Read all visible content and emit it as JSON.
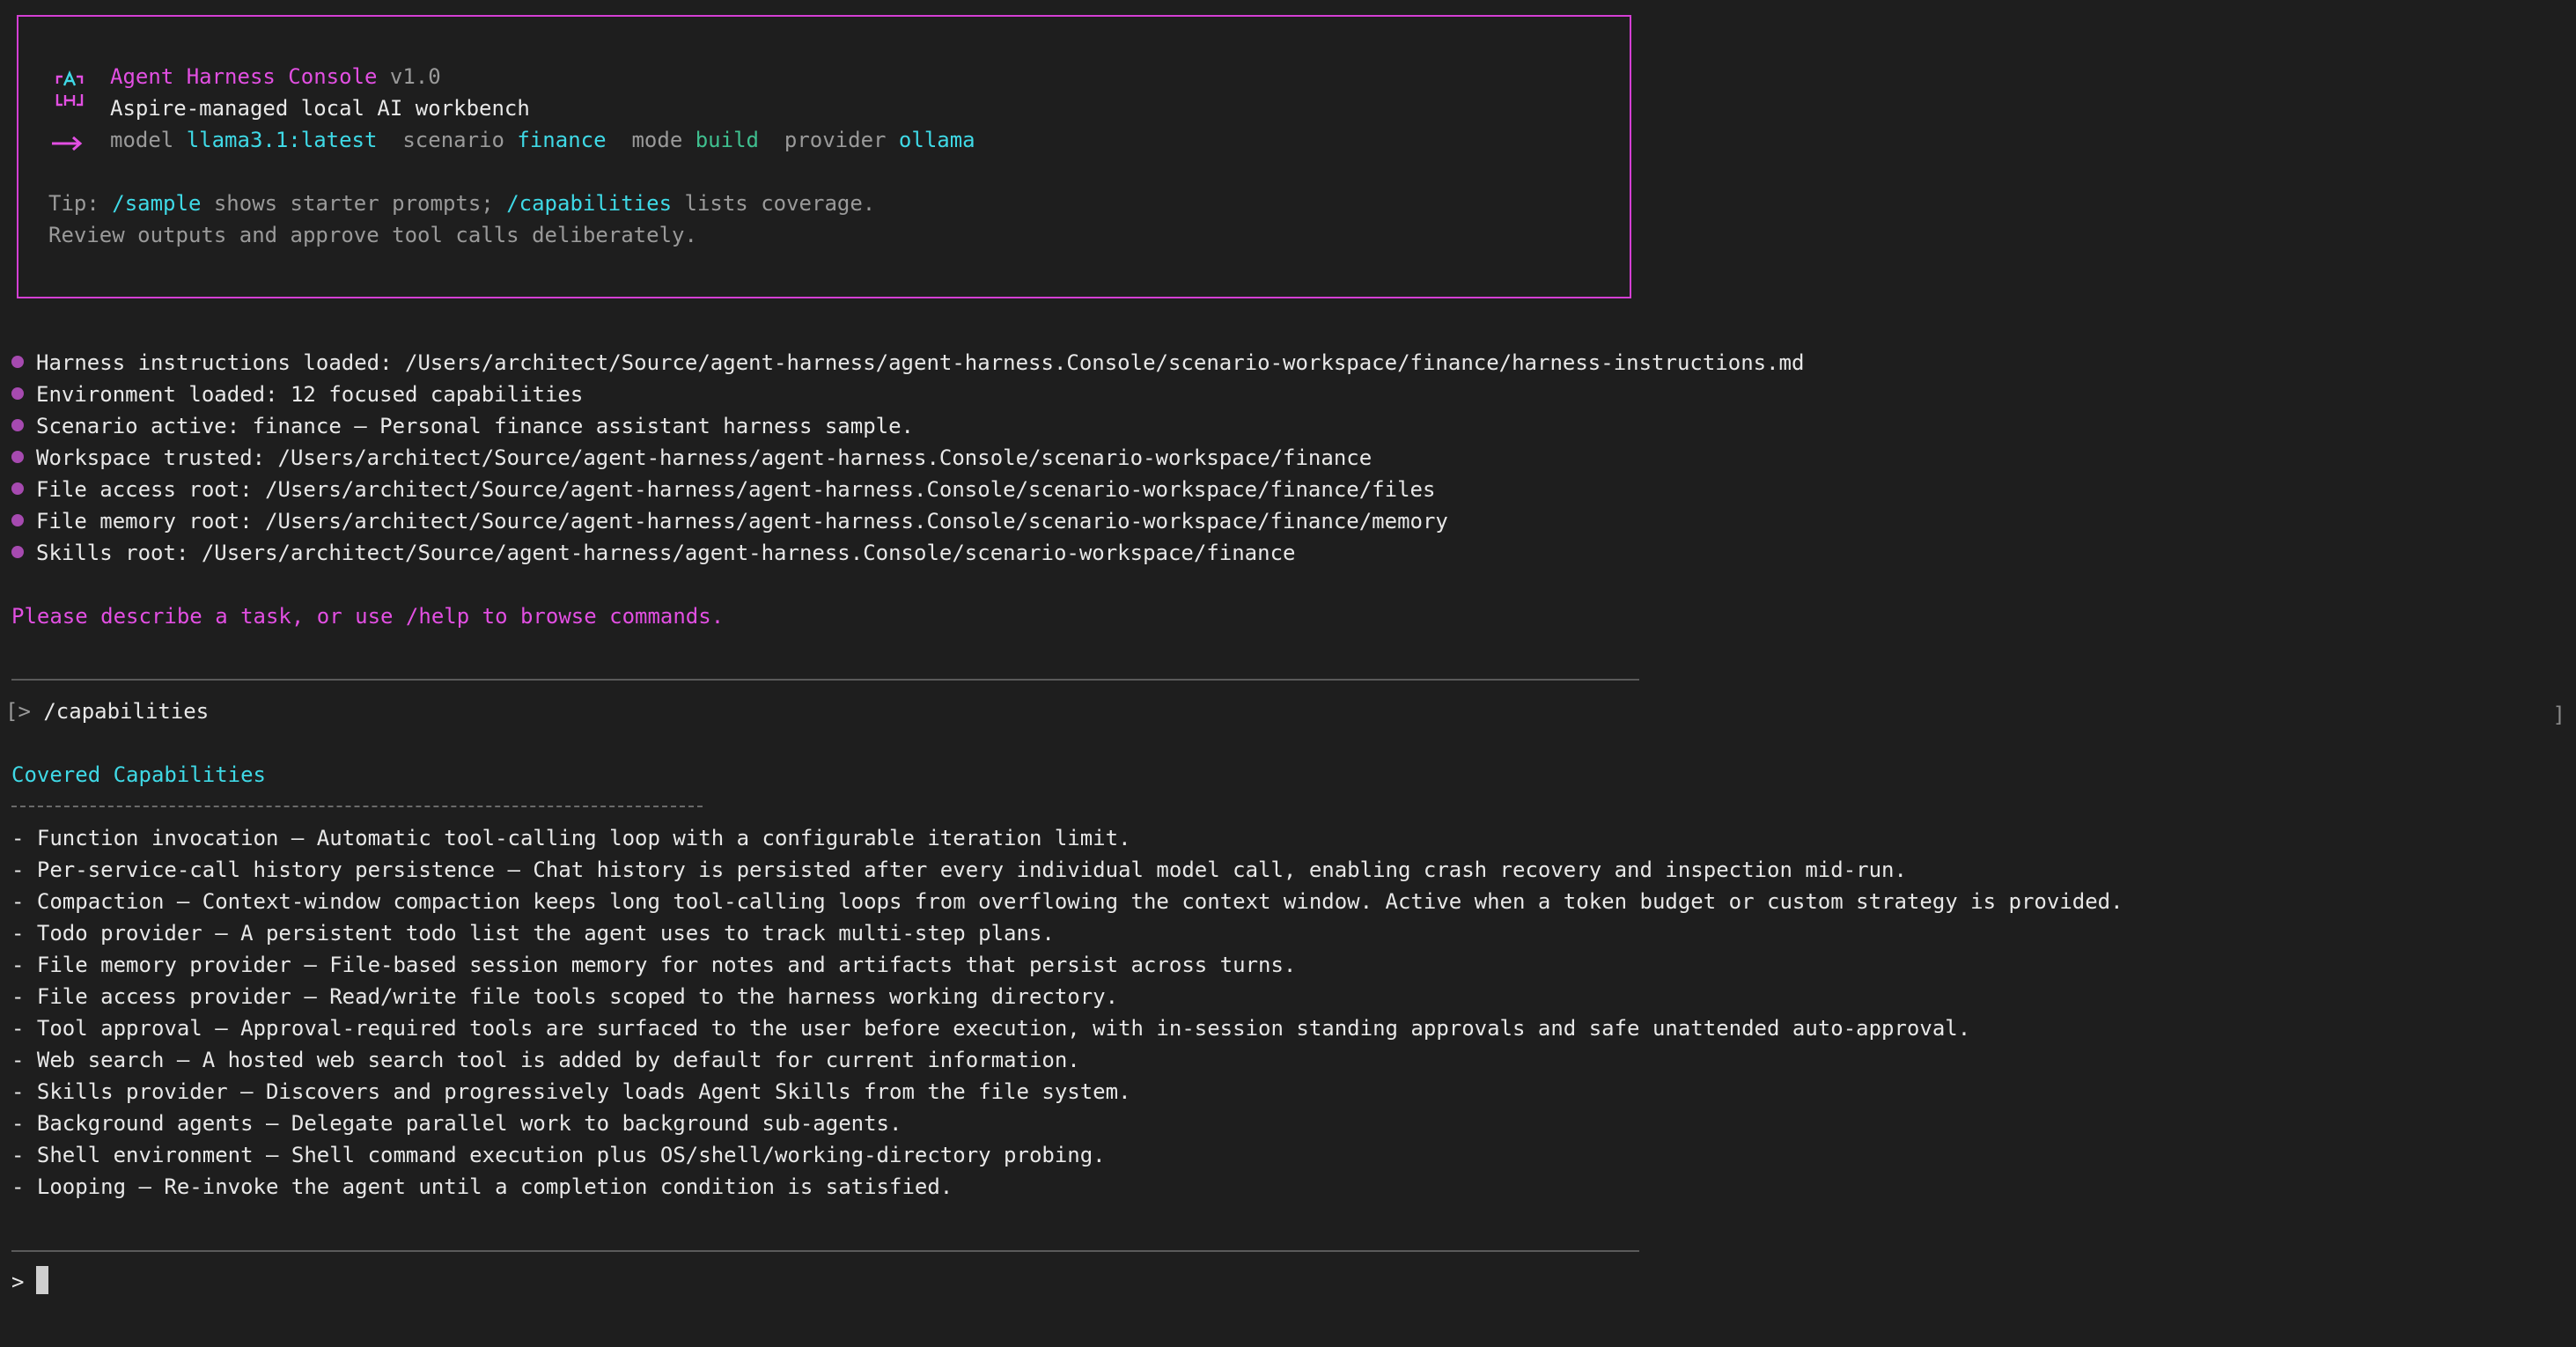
{
  "banner": {
    "app_name": "Agent Harness Console",
    "version": "v1.0",
    "subtitle": "Aspire-managed local AI workbench",
    "status": {
      "model_label": "model",
      "model_value": "llama3.1:latest",
      "scenario_label": "scenario",
      "scenario_value": "finance",
      "mode_label": "mode",
      "mode_value": "build",
      "provider_label": "provider",
      "provider_value": "ollama"
    },
    "tip": {
      "prefix": "Tip:",
      "cmd1": "/sample",
      "text1": "shows starter prompts;",
      "cmd2": "/capabilities",
      "text2": "lists coverage."
    },
    "tip2": "Review outputs and approve tool calls deliberately."
  },
  "status_lines": [
    "Harness instructions loaded: /Users/architect/Source/agent-harness/agent-harness.Console/scenario-workspace/finance/harness-instructions.md",
    "Environment loaded: 12 focused capabilities",
    "Scenario active: finance – Personal finance assistant harness sample.",
    "Workspace trusted: /Users/architect/Source/agent-harness/agent-harness.Console/scenario-workspace/finance",
    "File access root: /Users/architect/Source/agent-harness/agent-harness.Console/scenario-workspace/finance/files",
    "File memory root: /Users/architect/Source/agent-harness/agent-harness.Console/scenario-workspace/finance/memory",
    "Skills root: /Users/architect/Source/agent-harness/agent-harness.Console/scenario-workspace/finance"
  ],
  "prompt_hint": "Please describe a task, or use /help to browse commands.",
  "command_entry": {
    "prompt": "[>",
    "command": "/capabilities",
    "right_bracket": "]"
  },
  "capabilities": {
    "heading": "Covered Capabilities",
    "items": [
      "- Function invocation – Automatic tool-calling loop with a configurable iteration limit.",
      "- Per-service-call history persistence – Chat history is persisted after every individual model call, enabling crash recovery and inspection mid-run.",
      "- Compaction – Context-window compaction keeps long tool-calling loops from overflowing the context window. Active when a token budget or custom strategy is provided.",
      "- Todo provider – A persistent todo list the agent uses to track multi-step plans.",
      "- File memory provider – File-based session memory for notes and artifacts that persist across turns.",
      "- File access provider – Read/write file tools scoped to the harness working directory.",
      "- Tool approval – Approval-required tools are surfaced to the user before execution, with in-session standing approvals and safe unattended auto-approval.",
      "- Web search – A hosted web search tool is added by default for current information.",
      "- Skills provider – Discovers and progressively loads Agent Skills from the file system.",
      "- Background agents – Delegate parallel work to background sub-agents.",
      "- Shell environment – Shell command execution plus OS/shell/working-directory probing.",
      "- Looping – Re-invoke the agent until a completion condition is satisfied."
    ]
  },
  "input_prompt": ">",
  "colors": {
    "background": "#1e1e1e",
    "accent_magenta": "#e24fe2",
    "accent_cyan": "#3fd9e6",
    "accent_green": "#3fbf8f",
    "bullet": "#a64ab0"
  }
}
